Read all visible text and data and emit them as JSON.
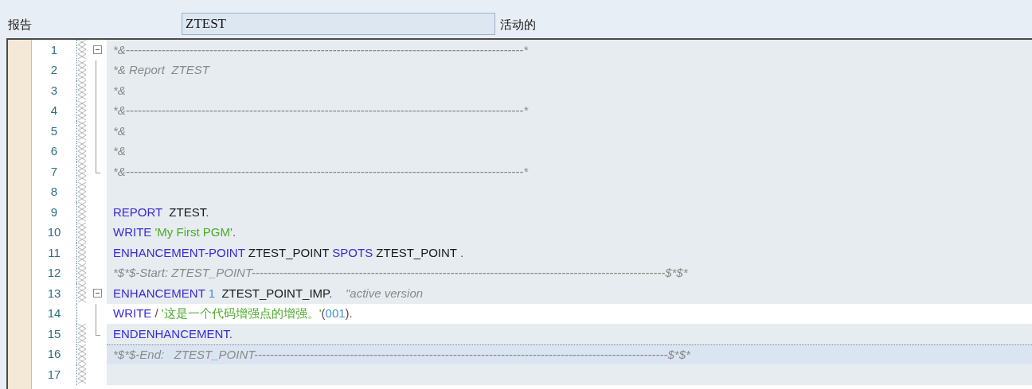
{
  "header": {
    "label": "报告",
    "program_field": {
      "value": "ZTEST"
    },
    "status": "活动的"
  },
  "editor": {
    "lines": [
      {
        "number": "1",
        "fold": {
          "kind": "start"
        },
        "changed": true,
        "editable": false,
        "current": false,
        "tokens": [
          {
            "kind": "comment",
            "text": "*&----------------------------------------------------------------------------------------------------*"
          }
        ]
      },
      {
        "number": "2",
        "fold": {
          "kind": "line"
        },
        "changed": true,
        "editable": false,
        "current": false,
        "tokens": [
          {
            "kind": "comment",
            "text": "*& Report  ZTEST"
          }
        ]
      },
      {
        "number": "3",
        "fold": {
          "kind": "line"
        },
        "changed": true,
        "editable": false,
        "current": false,
        "tokens": [
          {
            "kind": "comment",
            "text": "*&"
          }
        ]
      },
      {
        "number": "4",
        "fold": {
          "kind": "line"
        },
        "changed": true,
        "editable": false,
        "current": false,
        "tokens": [
          {
            "kind": "comment",
            "text": "*&----------------------------------------------------------------------------------------------------*"
          }
        ]
      },
      {
        "number": "5",
        "fold": {
          "kind": "line"
        },
        "changed": true,
        "editable": false,
        "current": false,
        "tokens": [
          {
            "kind": "comment",
            "text": "*&"
          }
        ]
      },
      {
        "number": "6",
        "fold": {
          "kind": "line"
        },
        "changed": true,
        "editable": false,
        "current": false,
        "tokens": [
          {
            "kind": "comment",
            "text": "*&"
          }
        ]
      },
      {
        "number": "7",
        "fold": {
          "kind": "end"
        },
        "changed": true,
        "editable": false,
        "current": false,
        "tokens": [
          {
            "kind": "comment",
            "text": "*&----------------------------------------------------------------------------------------------------*"
          }
        ]
      },
      {
        "number": "8",
        "changed": true,
        "editable": false,
        "current": false
      },
      {
        "number": "9",
        "changed": true,
        "editable": false,
        "current": false,
        "tokens": [
          {
            "kind": "keyword",
            "text": "REPORT"
          },
          {
            "kind": "plain",
            "text": "  ZTEST"
          },
          {
            "kind": "punct",
            "text": "."
          }
        ]
      },
      {
        "number": "10",
        "changed": true,
        "editable": false,
        "current": false,
        "tokens": [
          {
            "kind": "keyword",
            "text": "WRITE"
          },
          {
            "kind": "string",
            "text": " 'My First PGM'"
          },
          {
            "kind": "punct",
            "text": "."
          }
        ]
      },
      {
        "number": "11",
        "changed": true,
        "editable": false,
        "current": false,
        "tokens": [
          {
            "kind": "keyword",
            "text": "ENHANCEMENT-POINT"
          },
          {
            "kind": "plain",
            "text": " ZTEST_POINT"
          },
          {
            "kind": "keyword",
            "text": " SPOTS"
          },
          {
            "kind": "plain",
            "text": " ZTEST_POINT"
          },
          {
            "kind": "punct",
            "text": " ."
          }
        ]
      },
      {
        "number": "12",
        "changed": true,
        "editable": false,
        "current": false,
        "tokens": [
          {
            "kind": "comment",
            "text": "*$*$-Start: ZTEST_POINT--------------------------------------------------------------------------------------------------------$*$*"
          }
        ]
      },
      {
        "number": "13",
        "fold": {
          "kind": "start"
        },
        "changed": true,
        "editable": false,
        "current": false,
        "tokens": [
          {
            "kind": "keyword",
            "text": "ENHANCEMENT"
          },
          {
            "kind": "number",
            "text": " 1"
          },
          {
            "kind": "plain",
            "text": "  ZTEST_POINT_IMP"
          },
          {
            "kind": "punct",
            "text": "."
          },
          {
            "kind": "comment",
            "text": "    \"active version"
          }
        ]
      },
      {
        "number": "14",
        "fold": {
          "kind": "line"
        },
        "changed": false,
        "editable": true,
        "current": false,
        "tokens": [
          {
            "kind": "keyword",
            "text": "WRITE"
          },
          {
            "kind": "punct",
            "text": " /"
          },
          {
            "kind": "string",
            "text": " '这是一个代码增强点的增强。'"
          },
          {
            "kind": "punct",
            "text": "("
          },
          {
            "kind": "number",
            "text": "001"
          },
          {
            "kind": "punct",
            "text": ")."
          }
        ]
      },
      {
        "number": "15",
        "fold": {
          "kind": "end"
        },
        "changed": true,
        "editable": false,
        "current": false,
        "tokens": [
          {
            "kind": "keyword",
            "text": "ENDENHANCEMENT"
          },
          {
            "kind": "punct",
            "text": "."
          }
        ]
      },
      {
        "number": "16",
        "changed": true,
        "editable": false,
        "current": true,
        "tokens": [
          {
            "kind": "comment",
            "text": "*$*$-End:   ZTEST_POINT--------------------------------------------------------------------------------------------------------$*$*"
          }
        ]
      },
      {
        "number": "17",
        "changed": true,
        "editable": false,
        "current": false
      }
    ]
  }
}
